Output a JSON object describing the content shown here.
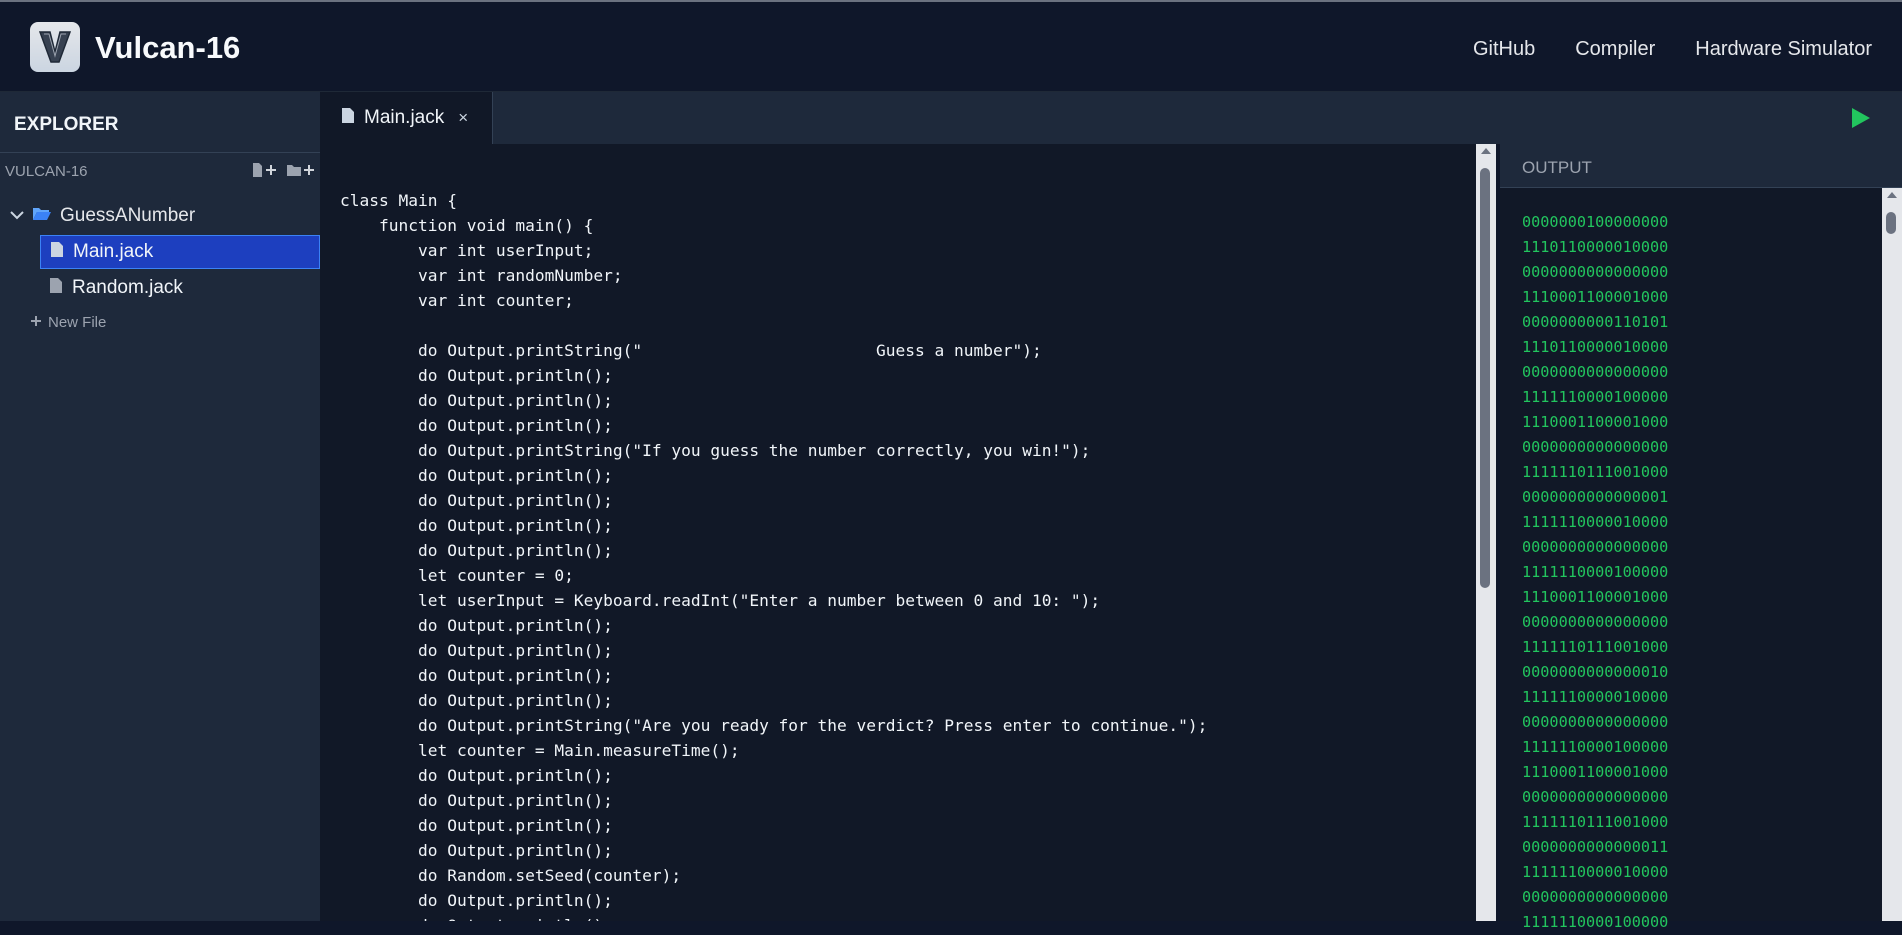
{
  "header": {
    "title": "Vulcan-16",
    "logo_letter": "V",
    "nav": [
      "GitHub",
      "Compiler",
      "Hardware Simulator"
    ]
  },
  "sidebar": {
    "title": "EXPLORER",
    "project": "VULCAN-16",
    "folder": "GuessANumber",
    "files": [
      {
        "name": "Main.jack",
        "selected": true
      },
      {
        "name": "Random.jack",
        "selected": false
      }
    ],
    "new_file_label": "New File"
  },
  "editor": {
    "tab_label": "Main.jack",
    "tab_close": "×",
    "lines": [
      "class Main {",
      "    function void main() {",
      "        var int userInput;",
      "        var int randomNumber;",
      "        var int counter;",
      "",
      "        do Output.printString(\"                        Guess a number\");",
      "        do Output.println();",
      "        do Output.println();",
      "        do Output.println();",
      "        do Output.printString(\"If you guess the number correctly, you win!\");",
      "        do Output.println();",
      "        do Output.println();",
      "        do Output.println();",
      "        do Output.println();",
      "        let counter = 0;",
      "        let userInput = Keyboard.readInt(\"Enter a number between 0 and 10: \");",
      "        do Output.println();",
      "        do Output.println();",
      "        do Output.println();",
      "        do Output.println();",
      "        do Output.printString(\"Are you ready for the verdict? Press enter to continue.\");",
      "        let counter = Main.measureTime();",
      "        do Output.println();",
      "        do Output.println();",
      "        do Output.println();",
      "        do Output.println();",
      "        do Random.setSeed(counter);",
      "        do Output.println();",
      "        do Output.println();"
    ]
  },
  "output": {
    "title": "OUTPUT",
    "lines": [
      "0000000100000000",
      "1110110000010000",
      "0000000000000000",
      "1110001100001000",
      "0000000000110101",
      "1110110000010000",
      "0000000000000000",
      "1111110000100000",
      "1110001100001000",
      "0000000000000000",
      "1111110111001000",
      "0000000000000001",
      "1111110000010000",
      "0000000000000000",
      "1111110000100000",
      "1110001100001000",
      "0000000000000000",
      "1111110111001000",
      "0000000000000010",
      "1111110000010000",
      "0000000000000000",
      "1111110000100000",
      "1110001100001000",
      "0000000000000000",
      "1111110111001000",
      "0000000000000011",
      "1111110000010000",
      "0000000000000000",
      "1111110000100000"
    ]
  },
  "colors": {
    "background": "#0f172a",
    "sidebar": "#1e293b",
    "editor": "#111827",
    "selected": "#1d3fbf",
    "output_text": "#22c55e",
    "run_icon": "#22c55e"
  },
  "icons": [
    "logo-icon",
    "file-plus-icon",
    "folder-plus-icon",
    "chevron-down-icon",
    "folder-open-icon",
    "file-icon",
    "plus-icon",
    "close-icon",
    "play-icon"
  ]
}
